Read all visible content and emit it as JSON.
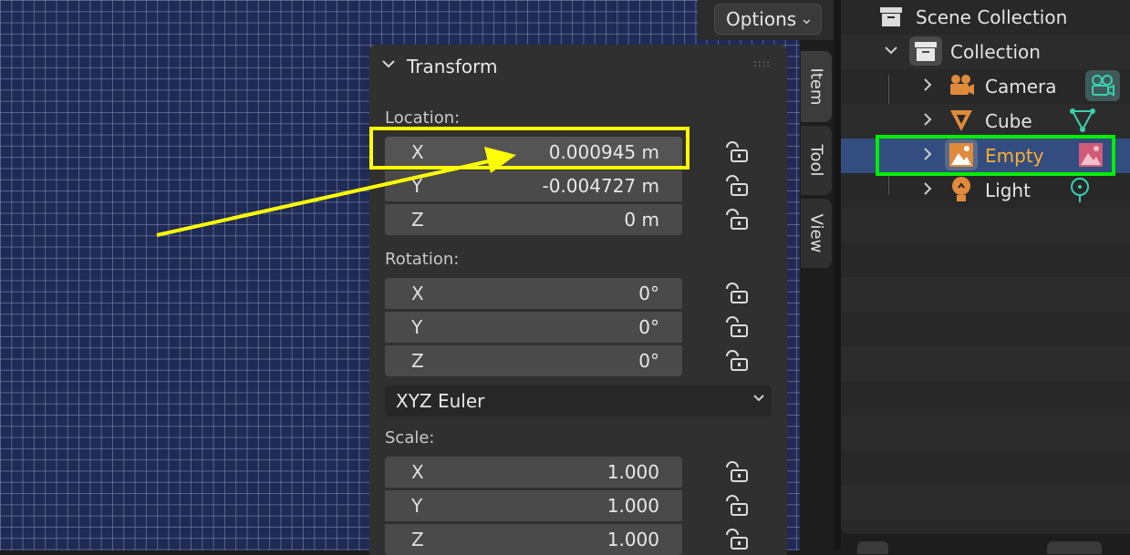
{
  "viewport": {
    "options_label": "Options"
  },
  "transform_panel": {
    "title": "Transform",
    "location": {
      "label": "Location:",
      "fields": [
        {
          "axis": "X",
          "value": "0.000945 m"
        },
        {
          "axis": "Y",
          "value": "-0.004727 m"
        },
        {
          "axis": "Z",
          "value": "0 m"
        }
      ]
    },
    "rotation": {
      "label": "Rotation:",
      "fields": [
        {
          "axis": "X",
          "value": "0°"
        },
        {
          "axis": "Y",
          "value": "0°"
        },
        {
          "axis": "Z",
          "value": "0°"
        }
      ]
    },
    "rotation_mode": "XYZ Euler",
    "scale": {
      "label": "Scale:",
      "fields": [
        {
          "axis": "X",
          "value": "1.000"
        },
        {
          "axis": "Y",
          "value": "1.000"
        },
        {
          "axis": "Z",
          "value": "1.000"
        }
      ]
    }
  },
  "side_tabs": [
    "Item",
    "Tool",
    "View"
  ],
  "outliner": {
    "scene_collection": "Scene Collection",
    "collection": "Collection",
    "objects": [
      {
        "name": "Camera",
        "icon": "camera-icon",
        "data_icon": "camera-data-icon"
      },
      {
        "name": "Cube",
        "icon": "mesh-icon",
        "data_icon": "mesh-data-icon"
      },
      {
        "name": "Empty",
        "icon": "image-empty-icon",
        "data_icon": "image-data-icon",
        "selected": true
      },
      {
        "name": "Light",
        "icon": "light-icon",
        "data_icon": "light-data-icon"
      }
    ]
  },
  "colors": {
    "highlight_yellow": "#ffff00",
    "highlight_green": "#00ee00",
    "active_object_text": "#ffaf29",
    "selection_row": "#334d80"
  }
}
